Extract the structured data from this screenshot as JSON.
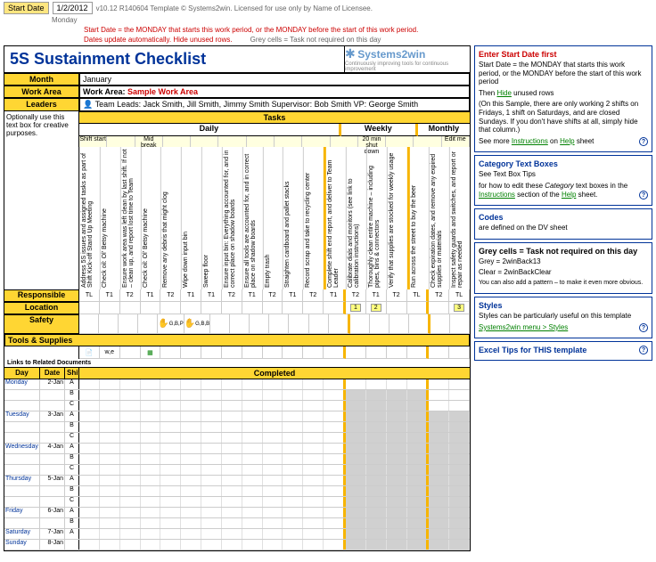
{
  "topbar": {
    "version": "v10.12 R140604  Template © Systems2win. Licensed for use only by Name of Licensee.",
    "start_label": "Start Date",
    "start_date": "1/2/2012",
    "dayname": "Monday"
  },
  "legend": {
    "red": "Start Date = the MONDAY that starts this work period, or the MONDAY before the start of this work period.",
    "red2": "Dates update automatically. Hide unused rows.",
    "grey": "Grey cells = Task not required on this day"
  },
  "title": "5S Sustainment Checklist",
  "logo": {
    "name": "Systems2win",
    "sub": "Continuously improving tools for continuous improvement"
  },
  "header": {
    "month_label": "Month",
    "month_val": "January",
    "area_label": "Work Area",
    "area_prefix": "Work Area:",
    "area_val": "Sample Work Area",
    "leaders_label": "Leaders",
    "leaders_val": "Team Leads: Jack Smith, Jill Smith, Jimmy Smith  Supervisor: Bob Smith  VP: George Smith"
  },
  "tasks_label": "Tasks",
  "note_left": "Optionally use this text box for creative purposes.",
  "periods": {
    "daily": "Daily",
    "weekly": "Weekly",
    "monthly": "Monthly"
  },
  "subperiods": [
    "Shift start",
    "",
    "Mid break",
    "",
    "",
    "",
    "",
    "",
    "",
    "",
    "20 min shut down",
    "",
    "",
    "Edit me"
  ],
  "tasks": [
    "Address 5S issues and assigned tasks as part of Shift Kick-off Stand Up Meeting",
    "Check oil: Ol' Betsy machine",
    "Ensure work area was left clean by last shift. If not – clean up, and report lost time to Team",
    "Check oil: Ol' Betsy machine",
    "Remove any debris that might clog",
    "Wipe down input bin",
    "Sweep floor",
    "Ensure input bin: Everything accounted for, and in correct place on shadow boards",
    "Ensure all tools are accounted for, and in correct place on shadow boards",
    "Empty trash",
    "Straighten cardboard and pallet stacks",
    "Record scrap and take to recycling center",
    "Complete shift end report, and deliver to Team Leader",
    "Calibrate dials and monitors (see link to calibration instructions)",
    "Thoroughly clean entire machine – including pipes, bins & connectors",
    "Verify that supplies are stocked for weekly usage",
    "Run across the street to buy the beer",
    "Check expiration dates, and remove any expired supplies or materials",
    "Inspect safety guards and switches, and report or repair as needed"
  ],
  "meta": {
    "responsible": "Responsible",
    "location": "Location",
    "safety": "Safety",
    "tools": "Tools & Supplies",
    "links": "Links to Related Documents"
  },
  "resp_cells": [
    "TL",
    "T1",
    "T2",
    "T1",
    "T2",
    "T1",
    "T1",
    "T2",
    "T1",
    "T2",
    "T1",
    "T2",
    "T1",
    "T2",
    "T1",
    "T2",
    "TL",
    "T2",
    "TL"
  ],
  "loc_cells": [
    "",
    "",
    "",
    "",
    "",
    "",
    "",
    "",
    "",
    "",
    "",
    "",
    "",
    "1",
    "2",
    "",
    "",
    "",
    "3"
  ],
  "safety_cells": [
    "",
    "",
    "",
    "",
    "G,B,P",
    "G,B,B",
    "",
    "",
    "",
    "",
    "",
    "",
    "",
    "",
    "",
    "",
    "",
    "",
    ""
  ],
  "tools_cells": [
    "",
    "w,e",
    "",
    "",
    "",
    "",
    "",
    "",
    "",
    "",
    "",
    "",
    "",
    "",
    "",
    "",
    "",
    "",
    ""
  ],
  "dayheader": {
    "day": "Day",
    "date": "Date",
    "shift": "Shift",
    "completed": "Completed"
  },
  "days": [
    {
      "name": "Monday",
      "date": "2-Jan",
      "shifts": [
        "A",
        "B",
        "C"
      ]
    },
    {
      "name": "Tuesday",
      "date": "3-Jan",
      "shifts": [
        "A",
        "B",
        "C"
      ]
    },
    {
      "name": "Wednesday",
      "date": "4-Jan",
      "shifts": [
        "A",
        "B",
        "C"
      ]
    },
    {
      "name": "Thursday",
      "date": "5-Jan",
      "shifts": [
        "A",
        "B",
        "C"
      ]
    },
    {
      "name": "Friday",
      "date": "6-Jan",
      "shifts": [
        "A",
        "B"
      ]
    },
    {
      "name": "Saturday",
      "date": "7-Jan",
      "shifts": [
        "A"
      ]
    },
    {
      "name": "Sunday",
      "date": "8-Jan",
      "shifts": []
    }
  ],
  "info": {
    "box1": {
      "title": "Enter Start Date first",
      "p1": "Start Date = the MONDAY that starts this work period, or the MONDAY before the start of this work period",
      "p2": "Then Hide unused rows",
      "p3": "(On this Sample, there are only working 2 shifts on Fridays, 1 shift on Saturdays, and are closed Sundays. If you don't have shifts at all, simply hide that column.)",
      "p4a": "See more ",
      "p4link": "Instructions",
      "p4b": " on ",
      "p4link2": "Help",
      "p4c": " sheet"
    },
    "box2": {
      "title": "Category Text Boxes",
      "p1": "See Text Box Tips",
      "p2a": "for how to edit these ",
      "p2em": "Category",
      "p2b": " text boxes in the ",
      "p2link": "Instructions",
      "p2c": " section of the ",
      "p2link2": "Help",
      "p2d": " sheet."
    },
    "box3": {
      "title": "Codes",
      "p1": "are defined on the DV sheet"
    },
    "box4": {
      "title": "Grey cells = Task not required on this day",
      "p1": "Grey = 2winBack13",
      "p2": "Clear = 2winBackClear",
      "p3": "You can also add a pattern – to make it even more obvious."
    },
    "box5": {
      "title": "Styles",
      "p1": "Styles can be particularly useful on this template",
      "link": "Systems2win menu > Styles"
    },
    "box6": {
      "title": "Excel Tips for THIS template"
    }
  }
}
